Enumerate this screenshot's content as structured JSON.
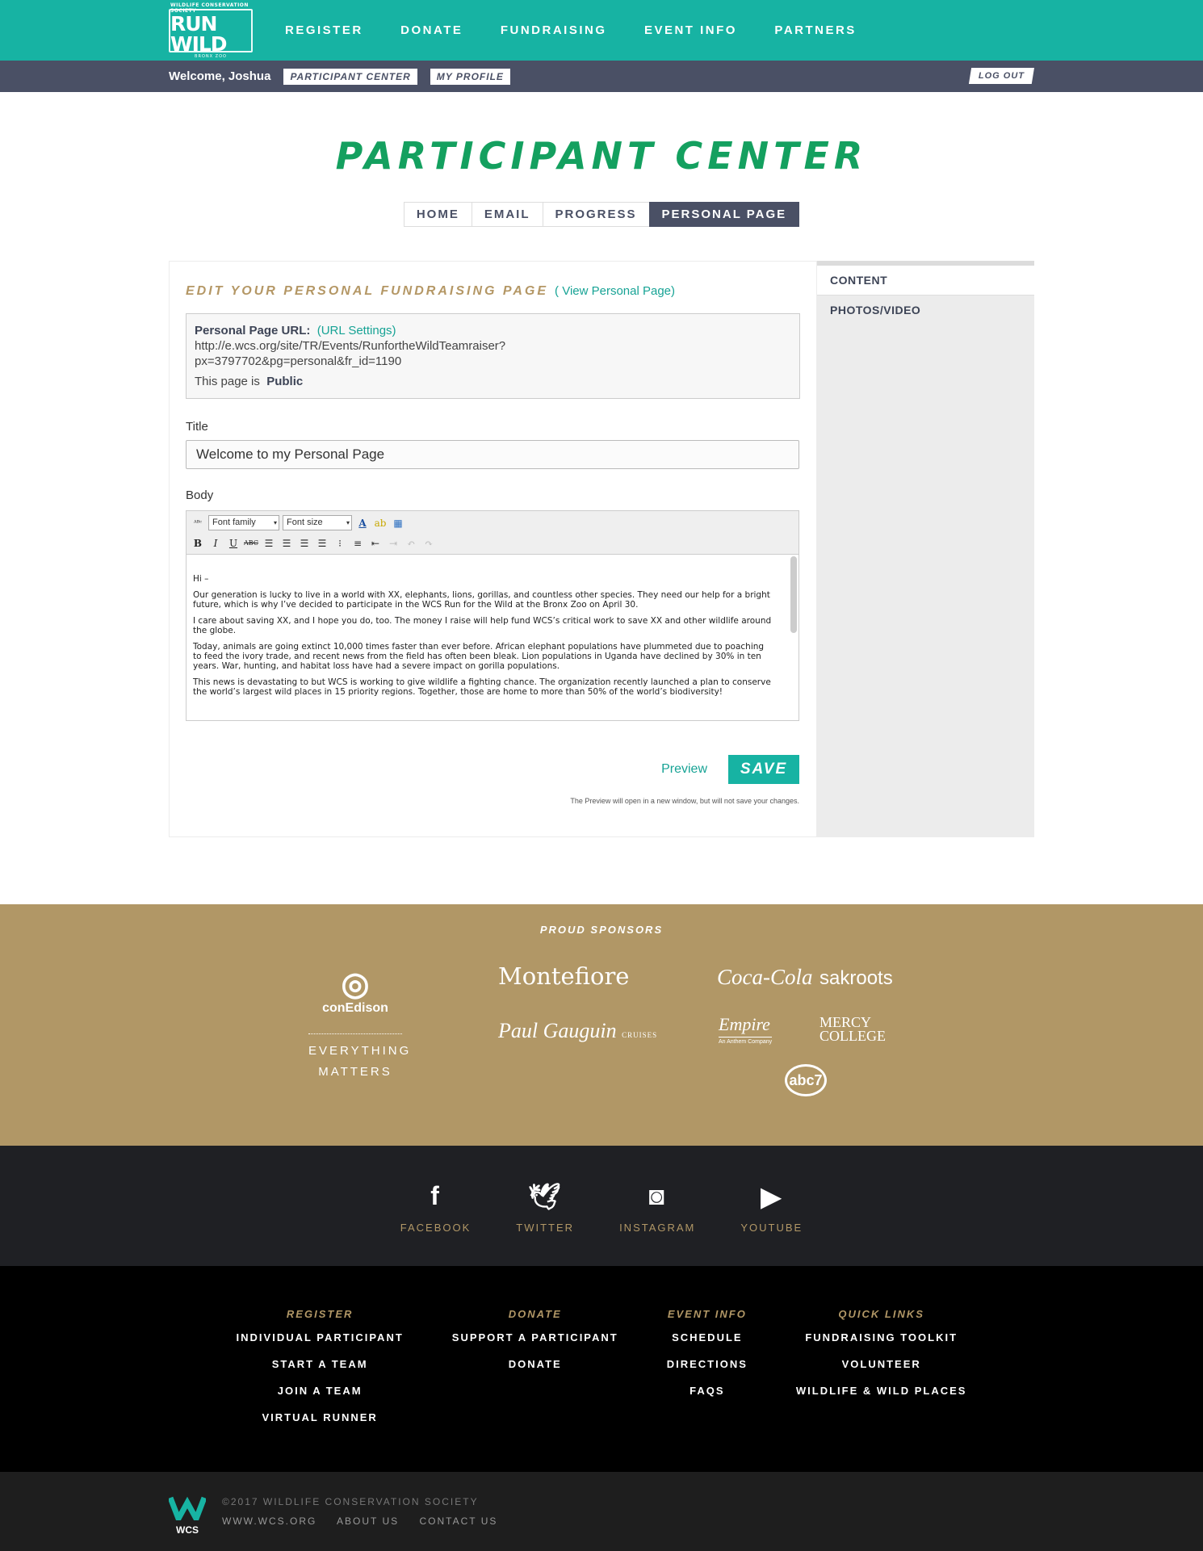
{
  "brand": {
    "org": "WILDLIFE CONSERVATION SOCIETY",
    "name": "RUN WILD",
    "sub": "BRONX ZOO"
  },
  "nav": [
    "REGISTER",
    "DONATE",
    "FUNDRAISING",
    "EVENT INFO",
    "PARTNERS"
  ],
  "subbar": {
    "welcome": "Welcome, Joshua",
    "participant_center": "PARTICIPANT CENTER",
    "my_profile": "MY PROFILE",
    "logout": "LOG OUT"
  },
  "page_title": "PARTICIPANT CENTER",
  "tabs": [
    "HOME",
    "EMAIL",
    "PROGRESS",
    "PERSONAL PAGE"
  ],
  "edit": {
    "heading": "EDIT YOUR PERSONAL FUNDRAISING PAGE",
    "view_link": "( View Personal Page)",
    "url_label": "Personal Page URL:",
    "url_settings": "(URL Settings)",
    "url_line1": "http://e.wcs.org/site/TR/Events/RunfortheWildTeamraiser?",
    "url_line2": "px=3797702&pg=personal&fr_id=1190",
    "public_label": "This page is",
    "public_value": "Public",
    "title_label": "Title",
    "title_value": "Welcome to my Personal Page",
    "body_label": "Body",
    "font_family": "Font family",
    "font_size": "Font size",
    "body_paragraphs": [
      "Hi –",
      "Our generation is lucky to live in a world with XX, elephants, lions, gorillas, and countless other species. They need our help for a bright future, which is why I’ve decided to participate in the WCS Run for the Wild at the Bronx Zoo on April 30.",
      "I care about saving XX, and I hope you do, too. The money I raise will help fund WCS’s critical work to save XX and other wildlife around the globe.",
      "Today, animals are going extinct 10,000 times faster than ever before. African elephant populations have plummeted due to poaching to feed the ivory trade, and recent news from the field has often been bleak. Lion populations in Uganda have declined by 30% in ten years. War, hunting, and habitat loss have had a severe impact on gorilla populations.",
      "This news is devastating to but WCS is working to give wildlife a fighting chance. The organization recently launched a plan to conserve the world’s largest wild places in 15 priority regions. Together, those are home to more than 50% of the world’s biodiversity!"
    ],
    "preview": "Preview",
    "save": "SAVE",
    "note": "The Preview will open in a new window, but will not save your changes."
  },
  "side": [
    "CONTENT",
    "PHOTOS/VIDEO"
  ],
  "sponsors": {
    "heading": "PROUD SPONSORS",
    "conedison": "conEdison",
    "everything1": "EVERYTHING",
    "everything2": "MATTERS",
    "montefiore": "Montefiore",
    "paulgauguin": "Paul Gauguin",
    "cruises": "CRUISES",
    "cocacola": "Coca-Cola",
    "sakroots": "sakroots",
    "empire": "Empire",
    "anthem": "An Anthem Company",
    "mercy": "MERCY COLLEGE",
    "abc": "abc7"
  },
  "social": [
    "FACEBOOK",
    "TWITTER",
    "INSTAGRAM",
    "YOUTUBE"
  ],
  "footer": {
    "cols": [
      {
        "h": "REGISTER",
        "items": [
          "INDIVIDUAL PARTICIPANT",
          "START A TEAM",
          "JOIN A TEAM",
          "VIRTUAL RUNNER"
        ]
      },
      {
        "h": "DONATE",
        "items": [
          "SUPPORT A PARTICIPANT",
          "DONATE"
        ]
      },
      {
        "h": "EVENT INFO",
        "items": [
          "SCHEDULE",
          "DIRECTIONS",
          "FAQS"
        ]
      },
      {
        "h": "QUICK LINKS",
        "items": [
          "FUNDRAISING TOOLKIT",
          "VOLUNTEER",
          "WILDLIFE & WILD PLACES"
        ]
      }
    ],
    "copyright": "©2017 WILDLIFE CONSERVATION SOCIETY",
    "links": [
      "WWW.WCS.ORG",
      "ABOUT US",
      "CONTACT US"
    ],
    "wcs": "WCS"
  }
}
